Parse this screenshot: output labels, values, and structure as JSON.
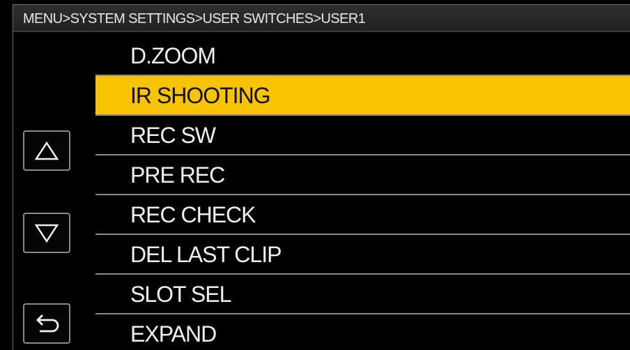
{
  "header": {
    "breadcrumb": "MENU>SYSTEM SETTINGS>USER SWITCHES>USER1"
  },
  "menu": {
    "items": [
      {
        "label": "D.ZOOM",
        "selected": false
      },
      {
        "label": "IR SHOOTING",
        "selected": true
      },
      {
        "label": "REC SW",
        "selected": false
      },
      {
        "label": "PRE REC",
        "selected": false
      },
      {
        "label": "REC CHECK",
        "selected": false
      },
      {
        "label": "DEL LAST CLIP",
        "selected": false
      },
      {
        "label": "SLOT SEL",
        "selected": false
      },
      {
        "label": "EXPAND",
        "selected": false
      }
    ]
  },
  "side_buttons": {
    "up_icon": "up-triangle-icon",
    "down_icon": "down-triangle-icon",
    "back_icon": "return-arrow-icon"
  },
  "colors": {
    "selection": "#f8c300",
    "background": "#000000",
    "text": "#f0f0f0"
  }
}
